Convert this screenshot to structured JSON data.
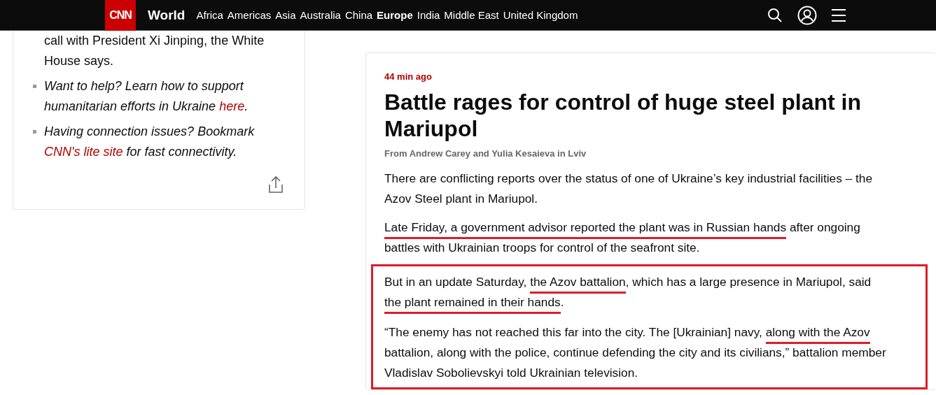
{
  "nav": {
    "logo": "CNN",
    "section": "World",
    "links": [
      {
        "label": "Africa",
        "selected": false
      },
      {
        "label": "Americas",
        "selected": false
      },
      {
        "label": "Asia",
        "selected": false
      },
      {
        "label": "Australia",
        "selected": false
      },
      {
        "label": "China",
        "selected": false
      },
      {
        "label": "Europe",
        "selected": true
      },
      {
        "label": "India",
        "selected": false
      },
      {
        "label": "Middle East",
        "selected": false
      },
      {
        "label": "United Kingdom",
        "selected": false
      }
    ]
  },
  "sidebar_card": {
    "items": [
      {
        "bullet": false,
        "italic": false,
        "segments": [
          {
            "text": "call with President Xi Jinping, the White House says.",
            "link": false
          }
        ]
      },
      {
        "bullet": true,
        "italic": true,
        "segments": [
          {
            "text": "Want to help? Learn how to support humanitarian efforts in Ukraine ",
            "link": false
          },
          {
            "text": "here",
            "link": true
          },
          {
            "text": ".",
            "link": false
          }
        ]
      },
      {
        "bullet": true,
        "italic": true,
        "segments": [
          {
            "text": "Having connection issues? Bookmark ",
            "link": false
          },
          {
            "text": "CNN's lite site",
            "link": true
          },
          {
            "text": " for fast connectivity.",
            "link": false
          }
        ]
      }
    ]
  },
  "post": {
    "time": "44 min ago",
    "headline": "Battle rages for control of huge steel plant in Mariupol",
    "byline": "From Andrew Carey and Yulia Kesaieva in Lviv",
    "paragraphs": [
      {
        "boxed": false,
        "segments": [
          {
            "text": "There are conflicting reports over the status of one of Ukraine’s key industrial facilities – the Azov Steel plant in Mariupol.",
            "underlined": false
          }
        ]
      },
      {
        "boxed": false,
        "segments": [
          {
            "text": "Late Friday, a government advisor reported the plant was in Russian hands",
            "underlined": true
          },
          {
            "text": " after ongoing battles with Ukrainian troops for control of the seafront site.",
            "underlined": false
          }
        ]
      },
      {
        "boxed": true,
        "segments": [
          {
            "text": "But in an update Saturday, ",
            "underlined": false
          },
          {
            "text": "the Azov battalion",
            "underlined": true
          },
          {
            "text": ", which has a large presence in Mariupol, said ",
            "underlined": false
          },
          {
            "text": "the plant remained in their hands",
            "underlined": true
          },
          {
            "text": ".",
            "underlined": false
          }
        ]
      },
      {
        "boxed": true,
        "segments": [
          {
            "text": "“The enemy has not reached this far into the city. The [Ukrainian] navy, ",
            "underlined": false
          },
          {
            "text": "along with the Azov",
            "underlined": true
          },
          {
            "text": " battalion, along with the police, continue defending the city and its civilians,” battalion member Vladislav Sobolievskyi told Ukrainian television.",
            "underlined": false
          }
        ]
      }
    ]
  }
}
